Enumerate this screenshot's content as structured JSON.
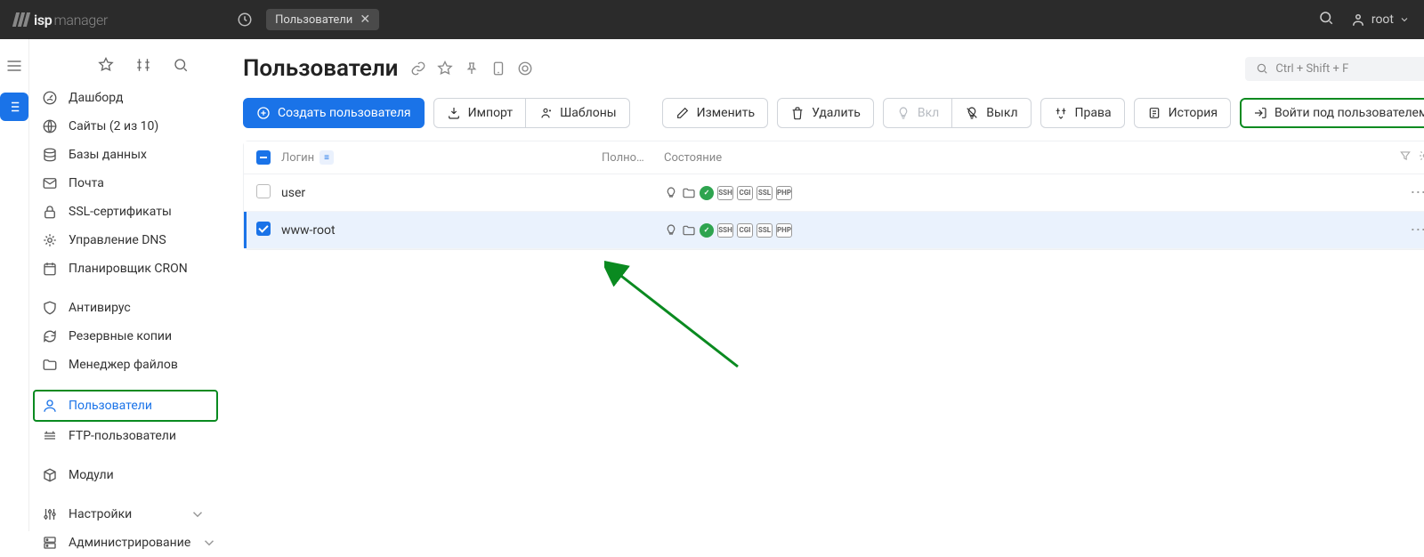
{
  "app": {
    "logo_bold": "isp",
    "logo_light": "manager"
  },
  "top": {
    "tab_label": "Пользователи",
    "user": "root"
  },
  "sidebar": {
    "items": [
      {
        "label": "Дашборд"
      },
      {
        "label": "Сайты (2 из 10)"
      },
      {
        "label": "Базы данных"
      },
      {
        "label": "Почта"
      },
      {
        "label": "SSL-сертификаты"
      },
      {
        "label": "Управление DNS"
      },
      {
        "label": "Планировщик CRON"
      },
      {
        "label": "Антивирус"
      },
      {
        "label": "Резервные копии"
      },
      {
        "label": "Менеджер файлов"
      },
      {
        "label": "Пользователи"
      },
      {
        "label": "FTP-пользователи"
      },
      {
        "label": "Модули"
      },
      {
        "label": "Настройки"
      },
      {
        "label": "Администрирование"
      }
    ]
  },
  "page": {
    "title": "Пользователи",
    "search_placeholder": "Ctrl + Shift + F"
  },
  "toolbar": {
    "create": "Создать пользователя",
    "import": "Импорт",
    "templates": "Шаблоны",
    "edit": "Изменить",
    "delete": "Удалить",
    "enable": "Вкл",
    "disable": "Выкл",
    "rights": "Права",
    "history": "История",
    "login_as": "Войти под пользователем"
  },
  "table": {
    "head": {
      "login": "Логин",
      "full": "Полно…",
      "state": "Состояние"
    },
    "rows": [
      {
        "login": "user",
        "selected": false
      },
      {
        "login": "www-root",
        "selected": true
      }
    ]
  },
  "badges": {
    "ssh": "SSH",
    "cgi": "CGI",
    "ssl": "SSL",
    "php": "PHP"
  }
}
